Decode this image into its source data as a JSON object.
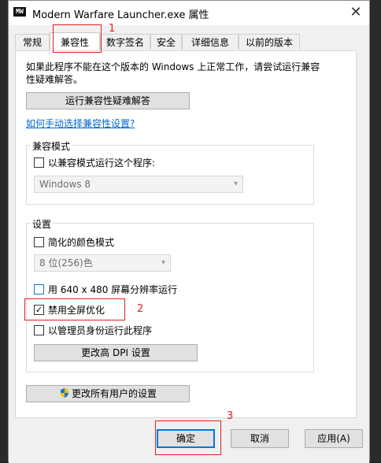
{
  "window": {
    "title": "Modern Warfare Launcher.exe 属性",
    "icon_text": "MW"
  },
  "tabs": [
    "常规",
    "兼容性",
    "数字签名",
    "安全",
    "详细信息",
    "以前的版本"
  ],
  "active_tab": "兼容性",
  "intro_text": "如果此程序不能在这个版本的 Windows 上正常工作，请尝试运行兼容性疑难解答。",
  "troubleshoot_button": "运行兼容性疑难解答",
  "manual_link": "如何手动选择兼容性设置?",
  "compat_mode": {
    "group_label": "兼容模式",
    "checkbox_label": "以兼容模式运行这个程序:",
    "checked": false,
    "select_value": "Windows 8"
  },
  "settings": {
    "group_label": "设置",
    "reduced_color": {
      "label": "简化的颜色模式",
      "checked": false
    },
    "color_select": "8 位(256)色",
    "resolution": {
      "label": "用 640 x 480 屏幕分辨率运行",
      "checked": false
    },
    "fullscreen_opt": {
      "label": "禁用全屏优化",
      "checked": true
    },
    "run_admin": {
      "label": "以管理员身份运行此程序",
      "checked": false
    },
    "dpi_button": "更改高 DPI 设置"
  },
  "all_users_button": "更改所有用户的设置",
  "footer": {
    "ok": "确定",
    "cancel": "取消",
    "apply": "应用(A)"
  },
  "annotations": [
    "1",
    "2",
    "3"
  ],
  "colors": {
    "accent": "#0078d7",
    "annotation": "#e02020",
    "link": "#0066cc"
  }
}
